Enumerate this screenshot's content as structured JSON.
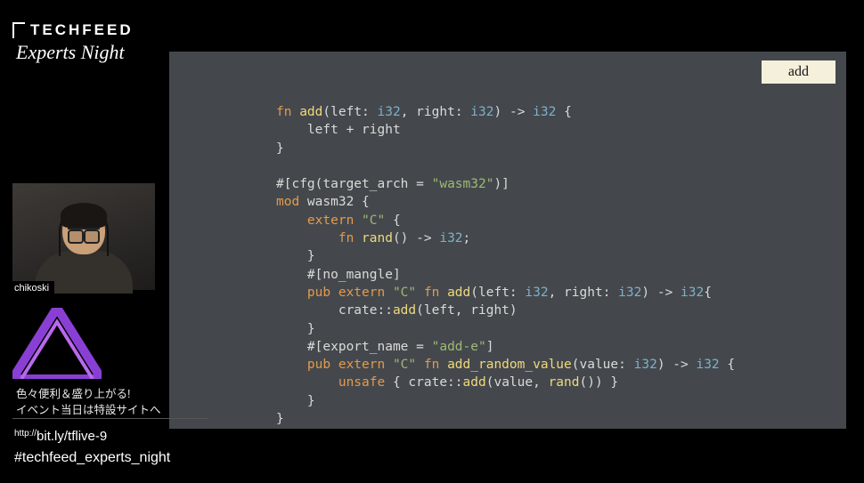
{
  "logo": {
    "main": "TECHFEED",
    "sub": "Experts Night"
  },
  "slide": {
    "tag": "add",
    "code": {
      "l1_kw1": "fn ",
      "l1_fn": "add",
      "l1_rest1": "(left: ",
      "l1_ty1": "i32",
      "l1_rest2": ", right: ",
      "l1_ty2": "i32",
      "l1_rest3": ") -> ",
      "l1_ty3": "i32",
      "l1_rest4": " {",
      "l2": "    left + right",
      "l3": "}",
      "l5_attr1": "#[cfg(target_arch = ",
      "l5_str": "\"wasm32\"",
      "l5_attr2": ")]",
      "l6_kw": "mod",
      "l6_rest": " wasm32 {",
      "l7_kw": "    extern ",
      "l7_str": "\"C\"",
      "l7_rest": " {",
      "l8_kw": "        fn ",
      "l8_fn": "rand",
      "l8_rest1": "() -> ",
      "l8_ty": "i32",
      "l8_rest2": ";",
      "l9": "    }",
      "l10": "    #[no_mangle]",
      "l11_kw": "    pub extern ",
      "l11_str": "\"C\"",
      "l11_kw2": " fn ",
      "l11_fn": "add",
      "l11_rest1": "(left: ",
      "l11_ty1": "i32",
      "l11_rest2": ", right: ",
      "l11_ty2": "i32",
      "l11_rest3": ") -> ",
      "l11_ty3": "i32",
      "l11_rest4": "{",
      "l12_pre": "        crate::",
      "l12_fn": "add",
      "l12_rest": "(left, right)",
      "l13": "    }",
      "l14_attr1": "    #[export_name = ",
      "l14_str": "\"add-e\"",
      "l14_attr2": "]",
      "l15_kw": "    pub extern ",
      "l15_str": "\"C\"",
      "l15_kw2": " fn ",
      "l15_fn": "add_random_value",
      "l15_rest1": "(value: ",
      "l15_ty": "i32",
      "l15_rest2": ") -> ",
      "l15_ty2": "i32",
      "l15_rest3": " {",
      "l16_kw": "        unsafe",
      "l16_rest1": " { crate::",
      "l16_fn": "add",
      "l16_rest2": "(value, ",
      "l16_fn2": "rand",
      "l16_rest3": "()) }",
      "l17": "    }",
      "l18": "}"
    }
  },
  "speaker": {
    "name": "chikoski"
  },
  "sidebar": {
    "line1": "色々便利＆盛り上がる!",
    "line2": "イベント当日は特設サイトへ",
    "url_prefix": "http://",
    "url": "bit.ly/tflive-9",
    "hashtag": "#techfeed_experts_night"
  }
}
